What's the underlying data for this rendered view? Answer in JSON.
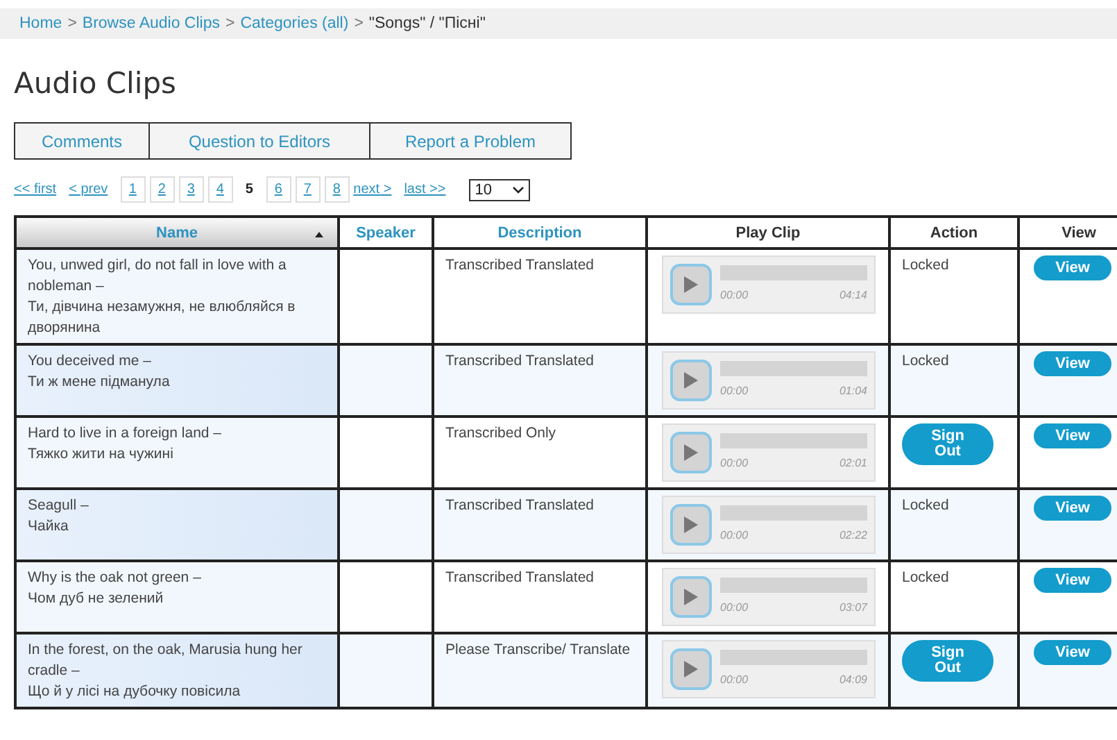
{
  "breadcrumb": [
    {
      "label": "Home",
      "link": true
    },
    {
      "label": "Browse Audio Clips",
      "link": true
    },
    {
      "label": "Categories (all)",
      "link": true
    },
    {
      "label": "\"Songs\" / \"Пісні\"",
      "link": false
    }
  ],
  "breadcrumb_separator": ">",
  "title": "Audio Clips",
  "tabs": [
    {
      "label": "Comments"
    },
    {
      "label": "Question to Editors"
    },
    {
      "label": "Report a Problem"
    }
  ],
  "pagination": {
    "first": "<< first",
    "prev": "< prev",
    "next": "next >",
    "last": "last >>",
    "pages": [
      {
        "label": "1",
        "selected": false
      },
      {
        "label": "2",
        "selected": false
      },
      {
        "label": "3",
        "selected": false
      },
      {
        "label": "4",
        "selected": false
      },
      {
        "label": "5",
        "selected": true
      },
      {
        "label": "6",
        "selected": false
      },
      {
        "label": "7",
        "selected": false
      },
      {
        "label": "8",
        "selected": false
      }
    ],
    "per_page": "10"
  },
  "table": {
    "columns": [
      {
        "label": "Name",
        "sortable": true,
        "sorted": true
      },
      {
        "label": "Speaker",
        "sortable": true,
        "sorted": false
      },
      {
        "label": "Description",
        "sortable": true,
        "sorted": false
      },
      {
        "label": "Play Clip",
        "sortable": false,
        "sorted": false
      },
      {
        "label": "Action",
        "sortable": false,
        "sorted": false
      },
      {
        "label": "View",
        "sortable": false,
        "sorted": false
      }
    ],
    "rows": [
      {
        "name": [
          "You, unwed girl, do not fall in love with a nobleman –",
          "Ти, дівчина незамужня, не влюбляйся в дворянина"
        ],
        "speaker": "",
        "description": "Transcribed Translated",
        "player": {
          "start": "00:00",
          "end": "04:14"
        },
        "action": {
          "kind": "text",
          "label": "Locked"
        },
        "view": "View"
      },
      {
        "name": [
          "You deceived me –",
          "Ти ж мене підманула"
        ],
        "speaker": "",
        "description": "Transcribed Translated",
        "player": {
          "start": "00:00",
          "end": "01:04"
        },
        "action": {
          "kind": "text",
          "label": "Locked"
        },
        "view": "View"
      },
      {
        "name": [
          "Hard to live in a foreign land –",
          "Тяжко жити на чужині"
        ],
        "speaker": "",
        "description": "Transcribed Only",
        "player": {
          "start": "00:00",
          "end": "02:01"
        },
        "action": {
          "kind": "button",
          "label": "Sign Out"
        },
        "view": "View"
      },
      {
        "name": [
          "Seagull –",
          "Чайка"
        ],
        "speaker": "",
        "description": "Transcribed Translated",
        "player": {
          "start": "00:00",
          "end": "02:22"
        },
        "action": {
          "kind": "text",
          "label": "Locked"
        },
        "view": "View"
      },
      {
        "name": [
          "Why is the oak not green –",
          "Чом дуб не зелений"
        ],
        "speaker": "",
        "description": "Transcribed Translated",
        "player": {
          "start": "00:00",
          "end": "03:07"
        },
        "action": {
          "kind": "text",
          "label": "Locked"
        },
        "view": "View"
      },
      {
        "name": [
          "In the forest, on the oak, Marusia hung her cradle –",
          "Що й у лісі на дубочку повісила"
        ],
        "speaker": "",
        "description": "Please Transcribe/ Translate",
        "player": {
          "start": "00:00",
          "end": "04:09"
        },
        "action": {
          "kind": "button",
          "label": "Sign Out"
        },
        "view": "View"
      }
    ]
  }
}
